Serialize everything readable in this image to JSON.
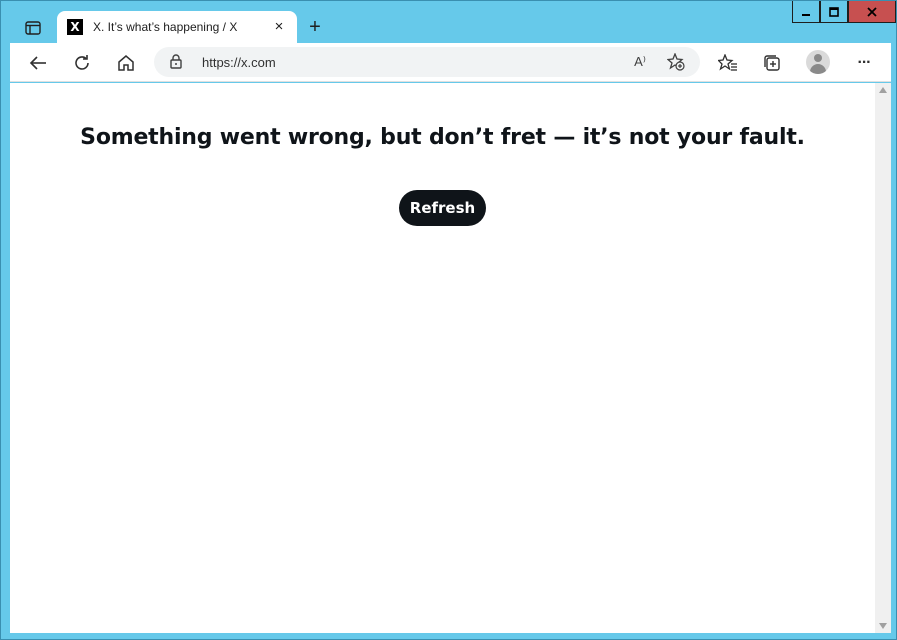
{
  "browser": {
    "tab": {
      "favicon_glyph": "X",
      "title": "X. It’s what’s happening / X",
      "close_glyph": "×"
    },
    "new_tab_glyph": "+",
    "window_controls": {
      "minimize_glyph": "▁",
      "maximize_glyph": "□",
      "close_glyph": "X"
    },
    "address_bar": {
      "url": "https://x.com"
    },
    "icons": {
      "tab_actions": "tab-actions-icon",
      "back": "back-arrow-icon",
      "reload": "reload-icon",
      "home": "home-icon",
      "lock": "lock-icon",
      "read_aloud": "read-aloud-icon",
      "add_favorite": "add-favorite-icon",
      "favorites": "favorites-icon",
      "collections": "collections-icon",
      "profile": "profile-avatar-icon",
      "more": "more-icon"
    },
    "more_glyph": "···",
    "read_aloud_glyph": "A⁾"
  },
  "page": {
    "error_title": "Something went wrong, but don’t fret — it’s not your fault.",
    "refresh_label": "Refresh"
  },
  "colors": {
    "frame": "#66c9ea",
    "close_button": "#c75050",
    "refresh_button": "#0f1419",
    "text": "#0f1419"
  }
}
